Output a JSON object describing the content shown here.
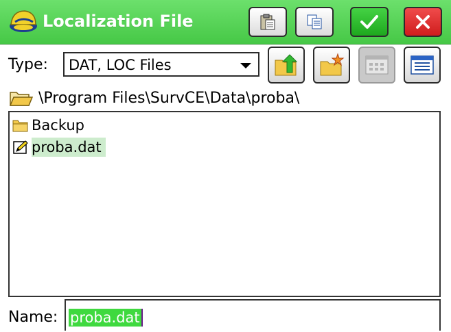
{
  "titlebar": {
    "title": "Localization File",
    "buttons": [
      "paste-icon",
      "copy-icon",
      "checkmark-icon",
      "close-icon"
    ],
    "colors": {
      "bar": "#46c846",
      "ok": "#1ea81e",
      "cancel": "#cf1d1d"
    }
  },
  "type_row": {
    "label": "Type:",
    "selected": "DAT, LOC Files",
    "buttons": [
      "folder-up-icon",
      "new-folder-icon",
      "list-view-icon",
      "details-view-icon"
    ]
  },
  "path": {
    "text": "\\Program Files\\SurvCE\\Data\\proba\\"
  },
  "files": [
    {
      "label": "Backup",
      "icon": "folder-icon",
      "selected": false
    },
    {
      "label": "proba.dat",
      "icon": "edit-file-icon",
      "selected": true
    }
  ],
  "name_field": {
    "label": "Name:",
    "value": "proba.dat"
  }
}
